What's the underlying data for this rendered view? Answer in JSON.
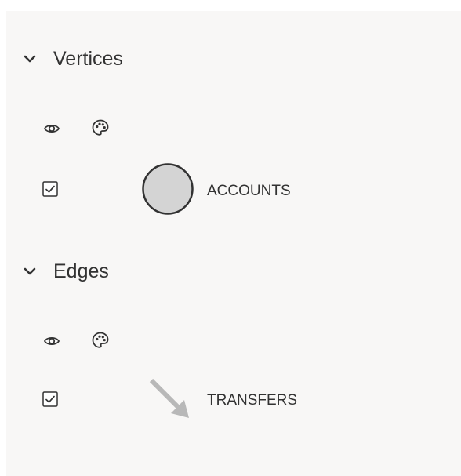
{
  "vertices": {
    "title": "Vertices",
    "items": [
      {
        "label": "ACCOUNTS",
        "checked": true,
        "color": "#d4d4d4"
      }
    ]
  },
  "edges": {
    "title": "Edges",
    "items": [
      {
        "label": "TRANSFERS",
        "checked": true,
        "color": "#b8b8b8"
      }
    ]
  },
  "icons": {
    "visibility": "eye-icon",
    "style": "palette-icon",
    "expand": "chevron-down-icon"
  }
}
